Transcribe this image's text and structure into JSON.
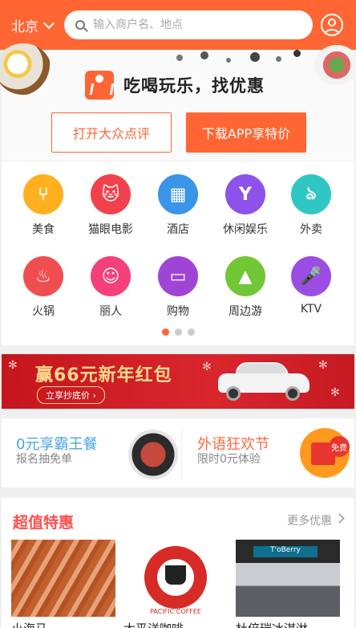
{
  "header": {
    "city": "北京",
    "search_placeholder": "输入商户名、地点"
  },
  "promo": {
    "slogan": "吃喝玩乐，找优惠",
    "open_app_label": "打开大众点评",
    "download_label": "下载APP享特价"
  },
  "categories": [
    {
      "label": "美食",
      "color": "#ffb01f",
      "icon": "fork-knife-icon",
      "glyph": "⑂"
    },
    {
      "label": "猫眼电影",
      "color": "#f2414d",
      "icon": "cat-icon",
      "glyph": "🐱"
    },
    {
      "label": "酒店",
      "color": "#3a95e8",
      "icon": "building-icon",
      "glyph": "▦"
    },
    {
      "label": "休闲娱乐",
      "color": "#8c52e9",
      "icon": "cocktail-icon",
      "glyph": "Y"
    },
    {
      "label": "外卖",
      "color": "#2fc7c4",
      "icon": "scooter-icon",
      "glyph": "ঌ"
    },
    {
      "label": "火锅",
      "color": "#f04e4e",
      "icon": "hotpot-icon",
      "glyph": "♨"
    },
    {
      "label": "丽人",
      "color": "#f6407a",
      "icon": "beauty-icon",
      "glyph": "☺"
    },
    {
      "label": "购物",
      "color": "#9f45d6",
      "icon": "shopping-bag-icon",
      "glyph": "▭"
    },
    {
      "label": "周边游",
      "color": "#71c736",
      "icon": "mountain-icon",
      "glyph": "▲"
    },
    {
      "label": "KTV",
      "color": "#9b4de3",
      "icon": "microphone-icon",
      "glyph": "🎤"
    }
  ],
  "pager": {
    "count": 3,
    "active": 0
  },
  "banner": {
    "headline": "赢66元新年红包",
    "cta": "立享抄底价 ›"
  },
  "cards": {
    "left": {
      "title": "0元享霸王餐",
      "subtitle": "报名抽免单"
    },
    "right": {
      "title": "外语狂欢节",
      "subtitle": "限时0元体验",
      "badge": "免费"
    }
  },
  "deals": {
    "title": "超值特惠",
    "more": "更多优惠",
    "items": [
      {
        "name": "小海马"
      },
      {
        "name": "太平洋咖啡"
      },
      {
        "name": "杜倍瑞冰淇淋"
      }
    ],
    "coffee_logo_text": "PACIFIC COFFEE",
    "shop_sign_text": "T'oBerry"
  }
}
